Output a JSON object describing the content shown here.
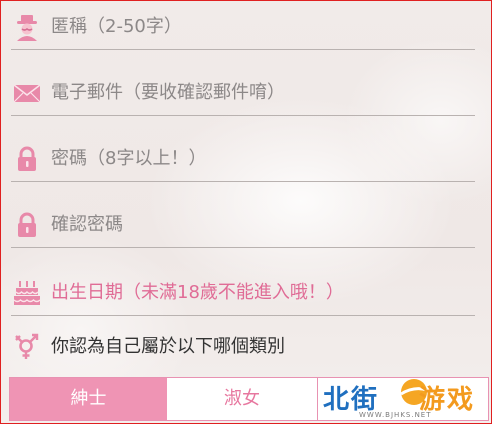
{
  "form": {
    "nickname_placeholder": "匿稱（2-50字）",
    "email_placeholder": "電子郵件（要收確認郵件唷）",
    "password_placeholder": "密碼（8字以上！）",
    "confirm_password_placeholder": "確認密碼",
    "birthdate_label": "出生日期（未滿18歲不能進入哦！）",
    "gender_question": "你認為自己屬於以下哪個類別",
    "gender_options": [
      "紳士",
      "淑女"
    ]
  },
  "watermark": {
    "brand_blue": "北街",
    "brand_orange": "游戏",
    "url": "WWW.BJHKS.NET"
  },
  "colors": {
    "accent_pink": "#ef94b4",
    "pink_text": "#e06c96",
    "divider": "#b9b2b0"
  },
  "icons": {
    "nickname": "person-hat-icon",
    "email": "envelope-icon",
    "password": "lock-icon",
    "confirm_password": "lock-icon",
    "birthdate": "cake-icon",
    "gender": "gender-icon"
  }
}
